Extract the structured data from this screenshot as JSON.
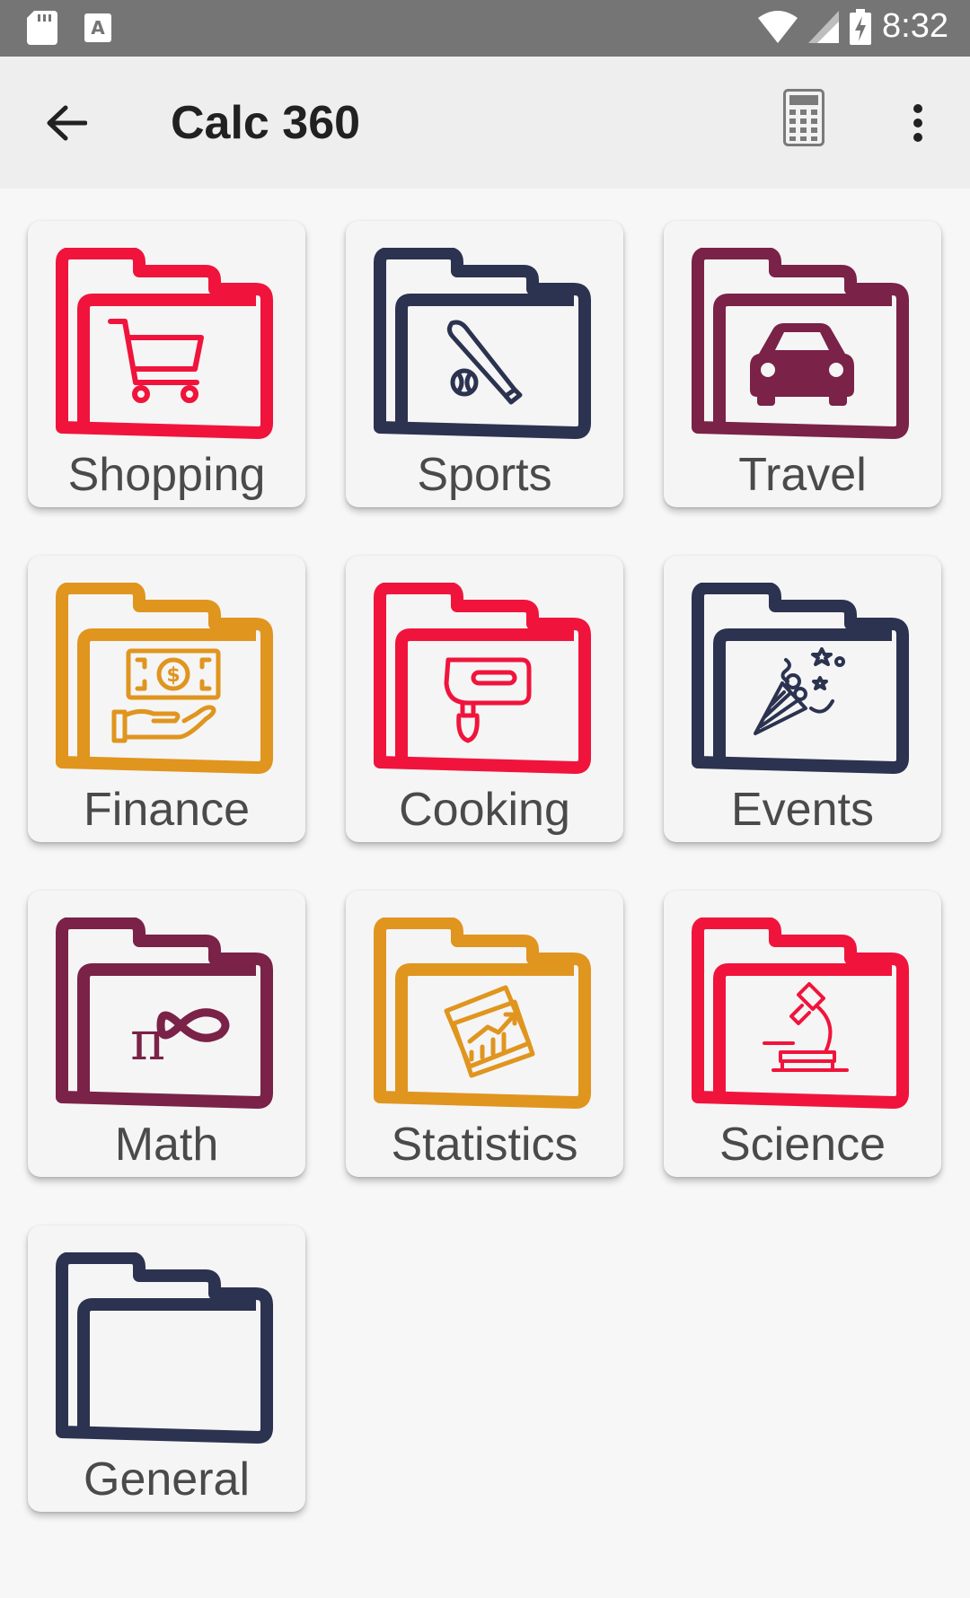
{
  "status_bar": {
    "time": "8:32",
    "icons": [
      "sd-card-icon",
      "text-a-icon",
      "wifi-icon",
      "signal-icon",
      "battery-charging-icon"
    ]
  },
  "app_bar": {
    "title": "Calc 360",
    "back_icon": "arrow-left-icon",
    "calculator_icon": "calculator-icon",
    "menu_icon": "more-vert-icon"
  },
  "categories": [
    {
      "label": "Shopping",
      "color": "#f0143c",
      "icon": "shopping-cart-icon"
    },
    {
      "label": "Sports",
      "color": "#2c3350",
      "icon": "baseball-bat-icon"
    },
    {
      "label": "Travel",
      "color": "#7a2248",
      "icon": "car-icon"
    },
    {
      "label": "Finance",
      "color": "#e0951f",
      "icon": "money-hand-icon"
    },
    {
      "label": "Cooking",
      "color": "#f0143c",
      "icon": "hand-mixer-icon"
    },
    {
      "label": "Events",
      "color": "#2c3350",
      "icon": "party-popper-icon"
    },
    {
      "label": "Math",
      "color": "#7a2248",
      "icon": "pi-infinity-icon"
    },
    {
      "label": "Statistics",
      "color": "#e0951f",
      "icon": "chart-photos-icon"
    },
    {
      "label": "Science",
      "color": "#f0143c",
      "icon": "microscope-icon"
    },
    {
      "label": "General",
      "color": "#2c3350",
      "icon": ""
    }
  ]
}
